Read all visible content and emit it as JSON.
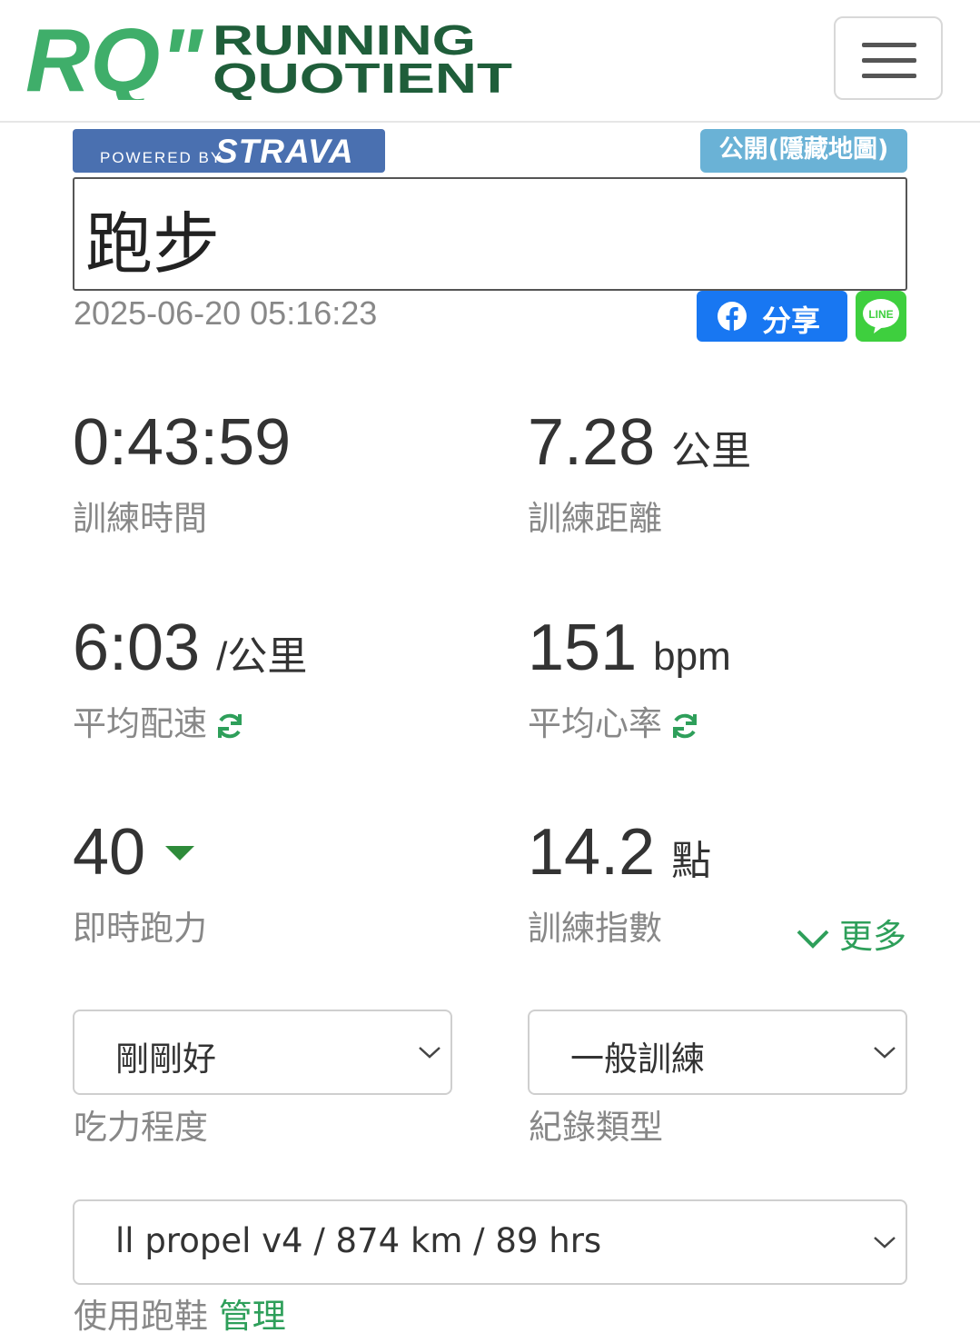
{
  "header": {
    "logo_mark": "RQ\"",
    "logo_line1": "RUNNING",
    "logo_line2": "QUOTIENT",
    "menu_icon": "hamburger-icon"
  },
  "strava": {
    "powered_by": "POWERED BY",
    "brand": "STRAVA"
  },
  "privacy_badge": "公開(隱藏地圖)",
  "activity": {
    "title": "跑步",
    "datetime": "2025-06-20 05:16:23"
  },
  "share": {
    "facebook_label": "分享",
    "line_text": "LINE"
  },
  "stats": {
    "time": {
      "value": "0:43:59",
      "label": "訓練時間"
    },
    "distance": {
      "value": "7.28",
      "unit": "公里",
      "label": "訓練距離"
    },
    "pace": {
      "value": "6:03",
      "unit": "/公里",
      "label": "平均配速"
    },
    "heart_rate": {
      "value": "151",
      "unit": "bpm",
      "label": "平均心率"
    },
    "running_power": {
      "value": "40",
      "label": "即時跑力"
    },
    "training_index": {
      "value": "14.2",
      "unit": "點",
      "label": "訓練指數"
    }
  },
  "more_label": "更多",
  "effort": {
    "selected": "剛剛好",
    "label": "吃力程度"
  },
  "record_type": {
    "selected": "一般訓練",
    "label": "紀錄類型"
  },
  "shoes": {
    "selected": "ll propel v4 / 874 km / 89 hrs",
    "label": "使用跑鞋",
    "manage": "管理"
  },
  "colors": {
    "accent_green": "#2e9f5a",
    "logo_green_light": "#3fae6a",
    "logo_green_dark": "#1f5e3a",
    "strava_blue": "#4a70b0",
    "privacy_blue": "#6ab2d6",
    "facebook_blue": "#1877f2",
    "line_green": "#3ecf3e"
  }
}
